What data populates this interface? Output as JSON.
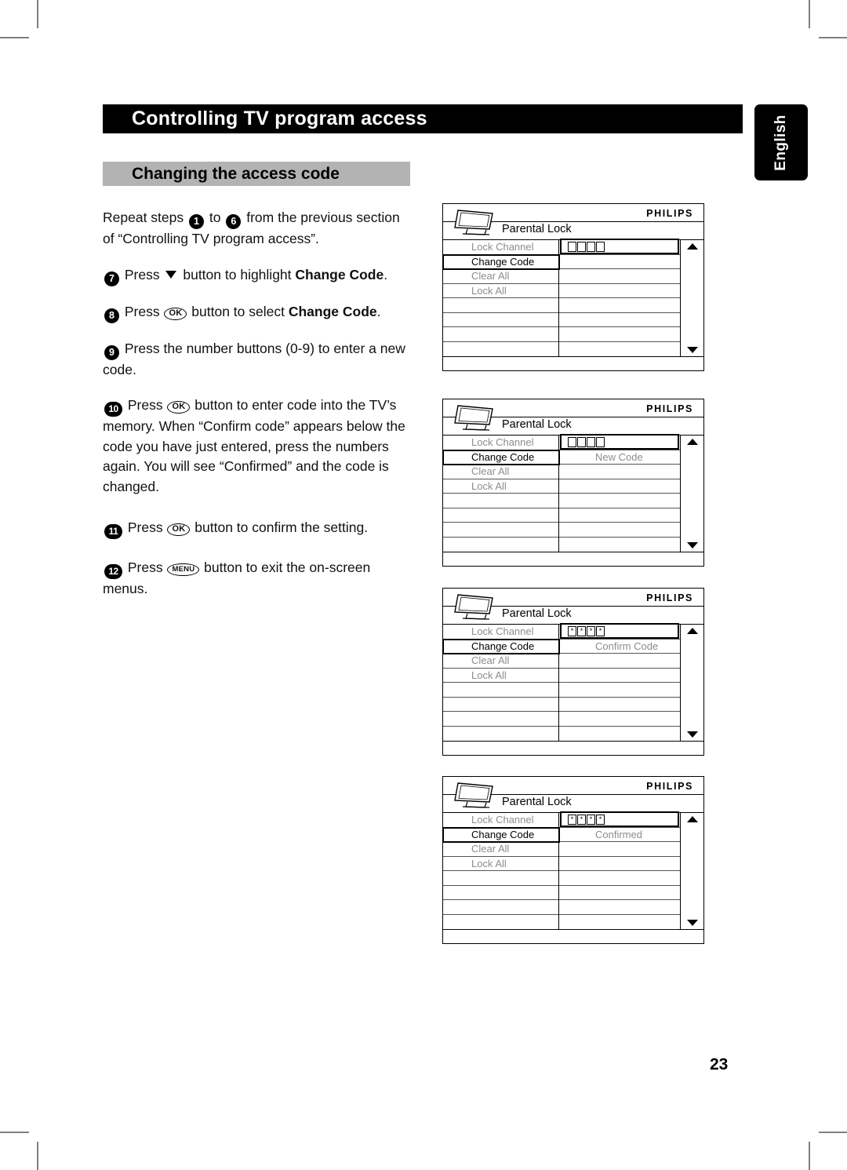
{
  "header": {
    "title": "Controlling TV program access",
    "language_tab": "English",
    "section_title": "Changing the access code"
  },
  "instructions": {
    "intro": {
      "lead": "Repeat steps",
      "step_from": "1",
      "mid": "to",
      "step_to": "6",
      "tail": "from the previous section of “Controlling TV program access”."
    },
    "steps": [
      {
        "number": "7",
        "text_before": "Press",
        "glyph": "down-arrow",
        "text_after": "button to highlight",
        "bold": "Change Code",
        "text_end": "."
      },
      {
        "number": "8",
        "text_before": "Press",
        "glyph": "OK",
        "text_after": "button to select",
        "bold": "Change Code",
        "text_end": "."
      },
      {
        "number": "9",
        "text": "Press the number buttons (0-9) to enter a new code."
      },
      {
        "number": "10",
        "text_before": "Press",
        "glyph": "OK",
        "text_after": "button to enter code into the TV’s memory.",
        "extra": "When “Confirm code” appears below the code you have just entered, press the numbers again. You will see “Confirmed” and the code is changed."
      },
      {
        "number": "11",
        "text_before": "Press",
        "glyph": "OK",
        "text_after": "button to confirm the setting."
      },
      {
        "number": "12",
        "text_before": "Press",
        "glyph": "MENU",
        "text_after": "button to exit the on-screen menus."
      }
    ]
  },
  "screens": [
    {
      "brand": "PHILIPS",
      "menu_title": "Parental Lock",
      "menu_items": [
        "Lock Channel",
        "Change Code",
        "Clear All",
        "Lock All"
      ],
      "selected_item": "Change Code",
      "code_digits": [
        "",
        "",
        "",
        ""
      ],
      "right_label": "",
      "scroll_up": "▲",
      "scroll_down": "▼"
    },
    {
      "brand": "PHILIPS",
      "menu_title": "Parental Lock",
      "menu_items": [
        "Lock Channel",
        "Change Code",
        "Clear All",
        "Lock All"
      ],
      "selected_item": "Change Code",
      "code_digits": [
        "",
        "",
        "",
        ""
      ],
      "right_label": "New Code",
      "scroll_up": "▲",
      "scroll_down": "▼"
    },
    {
      "brand": "PHILIPS",
      "menu_title": "Parental Lock",
      "menu_items": [
        "Lock Channel",
        "Change Code",
        "Clear All",
        "Lock All"
      ],
      "selected_item": "Change Code",
      "code_digits": [
        "*",
        "*",
        "*",
        "*"
      ],
      "right_label": "Confirm Code",
      "scroll_up": "▲",
      "scroll_down": "▼"
    },
    {
      "brand": "PHILIPS",
      "menu_title": "Parental Lock",
      "menu_items": [
        "Lock Channel",
        "Change Code",
        "Clear All",
        "Lock All"
      ],
      "selected_item": "Change Code",
      "code_digits": [
        "*",
        "*",
        "*",
        "*"
      ],
      "right_label": "Confirmed",
      "scroll_up": "▲",
      "scroll_down": "▼"
    }
  ],
  "footer": {
    "page_number": "23"
  },
  "colors": {
    "title_bar": "#000000",
    "section_bar": "#b3b3b3",
    "menu_dim_text": "#8c8c8c",
    "crop_mark": "#808080"
  }
}
